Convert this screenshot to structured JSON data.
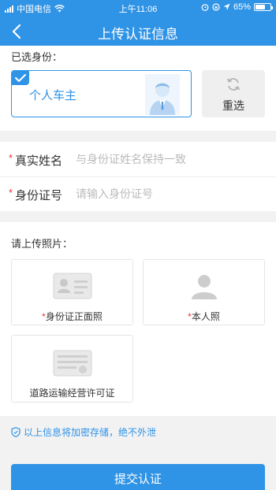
{
  "status_bar": {
    "carrier": "中国电信",
    "time": "上午11:06",
    "battery": "65%",
    "battery_level": 0.65
  },
  "nav": {
    "title": "上传认证信息"
  },
  "identity": {
    "section_label": "已选身份：",
    "selected_name": "个人车主",
    "reselect_label": "重选"
  },
  "form": {
    "name_label": "真实姓名",
    "name_placeholder": "与身份证姓名保持一致",
    "id_label": "身份证号",
    "id_placeholder": "请输入身份证号",
    "required_mark": "*"
  },
  "photos": {
    "section_label": "请上传照片：",
    "id_front": "身份证正面照",
    "portrait": "本人照",
    "permit": "道路运输经营许可证"
  },
  "notice": "以上信息将加密存储，绝不外泄",
  "submit_label": "提交认证",
  "colors": {
    "accent": "#2f93e6",
    "required": "#e53935"
  }
}
